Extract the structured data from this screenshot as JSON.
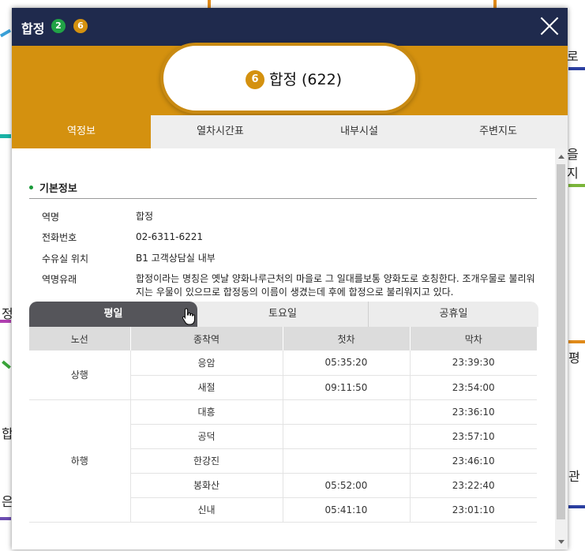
{
  "map_background": {
    "texts": [
      "로",
      "을지",
      "정",
      "평",
      "합",
      "은",
      "관"
    ]
  },
  "window": {
    "station_name": "합정",
    "line_badges": [
      {
        "number": "2",
        "color": "#21a346"
      },
      {
        "number": "6",
        "color": "#d4910f"
      }
    ],
    "close_icon": "close-icon"
  },
  "header": {
    "line_number": "6",
    "line_color": "#d4910f",
    "title": "합정 (622)"
  },
  "tabs": [
    {
      "label": "역정보",
      "active": true
    },
    {
      "label": "열차시간표",
      "active": false
    },
    {
      "label": "내부시설",
      "active": false
    },
    {
      "label": "주변지도",
      "active": false
    }
  ],
  "basic_info": {
    "heading": "기본정보",
    "rows": [
      {
        "label": "역명",
        "value": "합정"
      },
      {
        "label": "전화번호",
        "value": "02-6311-6221"
      },
      {
        "label": "수유실 위치",
        "value": "B1 고객상담실 내부"
      },
      {
        "label": "역명유래",
        "value": "합정이라는 명칭은 옛날 양화나루근처의 마을로 그 일대를보통 양화도로 호칭한다. 조개우물로 불리워지는 우물이 있으므로 합정동의 이름이 생겼는데 후에 합정으로 불리워지고 있다."
      }
    ]
  },
  "day_tabs": [
    {
      "label": "평일",
      "active": true
    },
    {
      "label": "토요일",
      "active": false
    },
    {
      "label": "공휴일",
      "active": false
    }
  ],
  "timetable": {
    "headers": [
      "노선",
      "종착역",
      "첫차",
      "막차"
    ],
    "groups": [
      {
        "direction": "상행",
        "rows": [
          {
            "terminal": "응암",
            "first": "05:35:20",
            "last": "23:39:30"
          },
          {
            "terminal": "새절",
            "first": "09:11:50",
            "last": "23:54:00"
          }
        ]
      },
      {
        "direction": "하행",
        "rows": [
          {
            "terminal": "대흥",
            "first": "",
            "last": "23:36:10"
          },
          {
            "terminal": "공덕",
            "first": "",
            "last": "23:57:10"
          },
          {
            "terminal": "한강진",
            "first": "",
            "last": "23:46:10"
          },
          {
            "terminal": "봉화산",
            "first": "05:52:00",
            "last": "23:22:40"
          },
          {
            "terminal": "신내",
            "first": "05:41:10",
            "last": "23:01:10"
          }
        ]
      }
    ]
  }
}
